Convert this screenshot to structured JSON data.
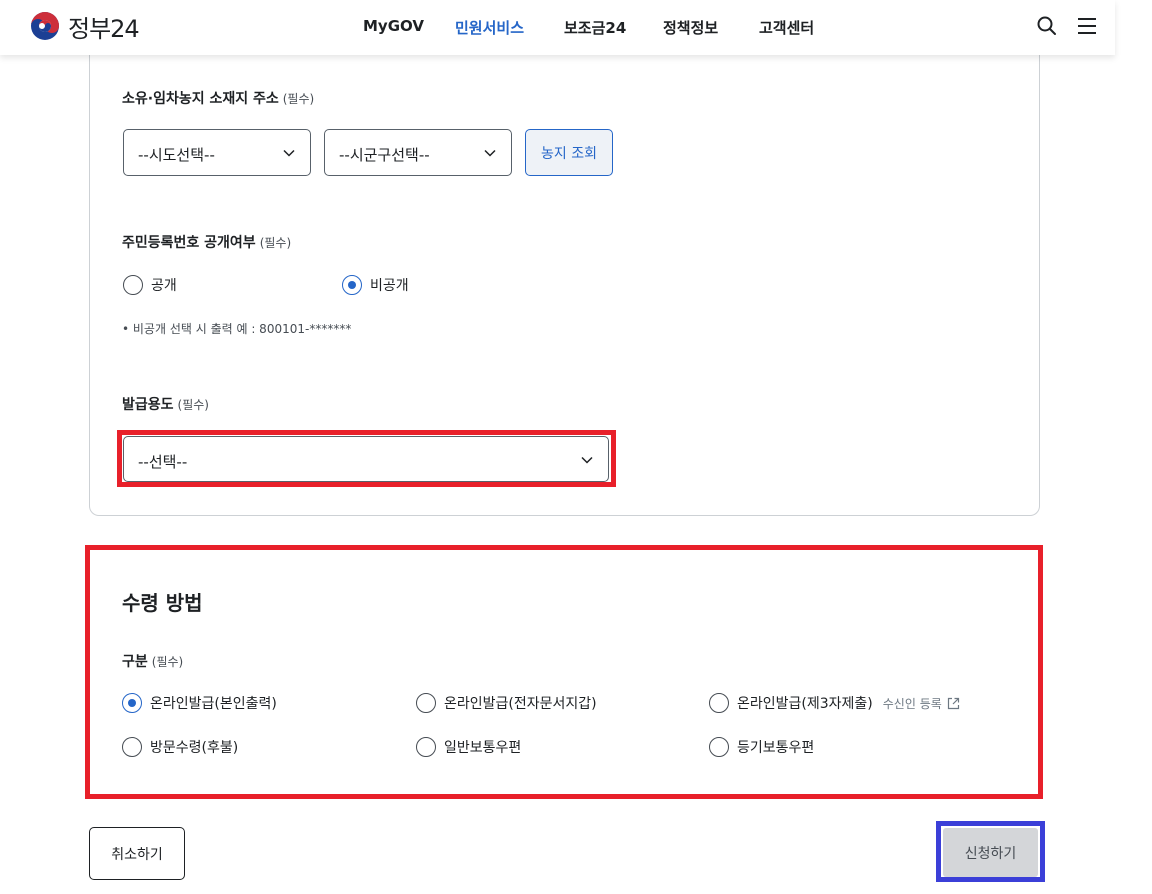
{
  "header": {
    "logo_text": "정부24",
    "nav": [
      {
        "label": "MyGOV"
      },
      {
        "label": "민원서비스"
      },
      {
        "label": "보조금24"
      },
      {
        "label": "정책정보"
      },
      {
        "label": "고객센터"
      }
    ],
    "active_nav": "민원서비스",
    "icons": [
      "search-icon",
      "menu-icon"
    ]
  },
  "form": {
    "address": {
      "label": "소유·임차농지 소재지 주소",
      "required": "(필수)",
      "sido_select": "--시도선택--",
      "sigungu_select": "--시군구선택--",
      "lookup_button": "농지 조회"
    },
    "rrn_disclosure": {
      "label": "주민등록번호 공개여부",
      "required": "(필수)",
      "options": [
        {
          "label": "공개",
          "checked": false
        },
        {
          "label": "비공개",
          "checked": true
        }
      ],
      "note": "• 비공개 선택 시 출력 예 : 800101-*******"
    },
    "purpose": {
      "label": "발급용도",
      "required": "(필수)",
      "select": "--선택--"
    }
  },
  "receipt": {
    "title": "수령 방법",
    "label": "구분",
    "required": "(필수)",
    "options": [
      {
        "label": "온라인발급(본인출력)",
        "checked": true
      },
      {
        "label": "온라인발급(전자문서지갑)",
        "checked": false
      },
      {
        "label": "온라인발급(제3자제출)",
        "checked": false
      },
      {
        "label": "방문수령(후불)",
        "checked": false
      },
      {
        "label": "일반보통우편",
        "checked": false
      },
      {
        "label": "등기보통우편",
        "checked": false
      }
    ],
    "third_party_link": "수신인 등록"
  },
  "buttons": {
    "cancel": "취소하기",
    "apply": "신청하기"
  },
  "colors": {
    "accent": "#2566c8",
    "highlight_red": "#e8202a",
    "highlight_blue": "#3b3fd8"
  }
}
